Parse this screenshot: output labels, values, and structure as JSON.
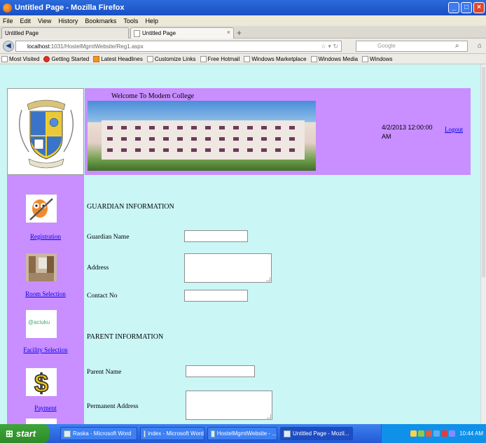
{
  "window": {
    "title": "Untitled Page - Mozilla Firefox"
  },
  "menu": [
    "File",
    "Edit",
    "View",
    "History",
    "Bookmarks",
    "Tools",
    "Help"
  ],
  "tabs": [
    {
      "label": "Untitled Page"
    },
    {
      "label": "Untitled Page"
    }
  ],
  "nav": {
    "url_host": "localhost",
    "url_path": ":1031/HostelMgmtWebsite/Reg1.aspx",
    "search_placeholder": "Google"
  },
  "bookmarks": [
    "Most Visited",
    "Getting Started",
    "Latest Headlines",
    "Customize Links",
    "Free Hotmail",
    "Windows Marketplace",
    "Windows Media",
    "Windows"
  ],
  "page": {
    "welcome": "Welcome To Modern College",
    "date": "4/2/2013 12:00:00 AM",
    "logout": "Logout",
    "sidebar": [
      {
        "label": "Registration",
        "icon": "registration-icon"
      },
      {
        "label": "Room Selection",
        "icon": "room-icon"
      },
      {
        "label": "Facility Selection",
        "icon": "facility-icon"
      },
      {
        "label": "Payment",
        "icon": "payment-icon"
      }
    ],
    "guardian_heading": "GUARDIAN INFORMATION",
    "guardian_name_label": "Guardian Name",
    "address_label": "Address",
    "contact_label": "Contact No",
    "parent_heading": "PARENT INFORMATION",
    "parent_name_label": "Parent Name",
    "permanent_address_label": "Permanent Address",
    "facility_logo_text": "@aciuku"
  },
  "taskbar": {
    "start": "start",
    "tasks": [
      "Raska - Microsoft Word",
      "index - Microsoft Word",
      "HostelMgmtWebsite - ...",
      "Untitled Page - Mozil..."
    ],
    "clock": "10:44 AM"
  },
  "colors": {
    "header_purple": "#c98eff",
    "page_cyan": "#caf6f6",
    "link": "#0000ee"
  }
}
